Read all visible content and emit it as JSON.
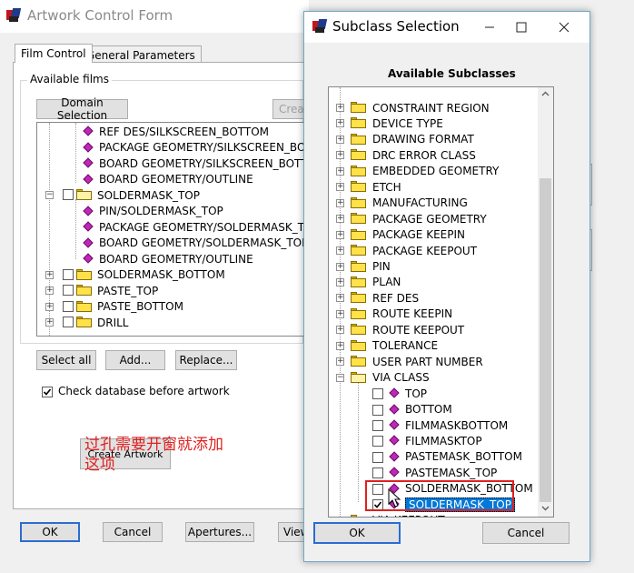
{
  "main_window": {
    "title": "Artwork Control Form",
    "tabs": [
      "Film Control",
      "General Parameters"
    ],
    "available_films_label": "Available films",
    "domain_selection": "Domain Selection",
    "create_partial": "Creat",
    "film_tree": [
      {
        "label": "REF DES/SILKSCREEN_BOTTOM",
        "type": "item",
        "indent": 2
      },
      {
        "label": "PACKAGE GEOMETRY/SILKSCREEN_BO",
        "type": "item",
        "indent": 2
      },
      {
        "label": "BOARD GEOMETRY/SILKSCREEN_BOTT",
        "type": "item",
        "indent": 2
      },
      {
        "label": "BOARD GEOMETRY/OUTLINE",
        "type": "item",
        "indent": 2
      },
      {
        "label": "SOLDERMASK_TOP",
        "type": "folder-open",
        "indent": 1
      },
      {
        "label": "PIN/SOLDERMASK_TOP",
        "type": "item",
        "indent": 2
      },
      {
        "label": "PACKAGE GEOMETRY/SOLDERMASK_T",
        "type": "item",
        "indent": 2
      },
      {
        "label": "BOARD GEOMETRY/SOLDERMASK_TOP",
        "type": "item",
        "indent": 2
      },
      {
        "label": "BOARD GEOMETRY/OUTLINE",
        "type": "item",
        "indent": 2
      },
      {
        "label": "SOLDERMASK_BOTTOM",
        "type": "folder",
        "indent": 1
      },
      {
        "label": "PASTE_TOP",
        "type": "folder",
        "indent": 1
      },
      {
        "label": "PASTE_BOTTOM",
        "type": "folder",
        "indent": 1
      },
      {
        "label": "DRILL",
        "type": "folder",
        "indent": 1
      }
    ],
    "select_all": "Select all",
    "add": "Add...",
    "replace": "Replace...",
    "check_db_label": "Check database before artwork",
    "check_db_checked": true,
    "create_artwork": "Create Artwork",
    "ok": "OK",
    "cancel": "Cancel",
    "apertures": "Apertures...",
    "view_partial": "View"
  },
  "dialog": {
    "title": "Subclass Selection",
    "heading": "Available Subclasses",
    "ok": "OK",
    "cancel": "Cancel",
    "tree": [
      {
        "label": "CONSTRAINT REGION",
        "type": "folder"
      },
      {
        "label": "DEVICE TYPE",
        "type": "folder"
      },
      {
        "label": "DRAWING FORMAT",
        "type": "folder"
      },
      {
        "label": "DRC ERROR CLASS",
        "type": "folder"
      },
      {
        "label": "EMBEDDED GEOMETRY",
        "type": "folder"
      },
      {
        "label": "ETCH",
        "type": "folder"
      },
      {
        "label": "MANUFACTURING",
        "type": "folder"
      },
      {
        "label": "PACKAGE GEOMETRY",
        "type": "folder"
      },
      {
        "label": "PACKAGE KEEPIN",
        "type": "folder"
      },
      {
        "label": "PACKAGE KEEPOUT",
        "type": "folder"
      },
      {
        "label": "PIN",
        "type": "folder"
      },
      {
        "label": "PLAN",
        "type": "folder"
      },
      {
        "label": "REF DES",
        "type": "folder"
      },
      {
        "label": "ROUTE KEEPIN",
        "type": "folder"
      },
      {
        "label": "ROUTE KEEPOUT",
        "type": "folder"
      },
      {
        "label": "TOLERANCE",
        "type": "folder"
      },
      {
        "label": "USER PART NUMBER",
        "type": "folder"
      },
      {
        "label": "VIA CLASS",
        "type": "folder-open"
      },
      {
        "label": "TOP",
        "type": "item",
        "checked": false
      },
      {
        "label": "BOTTOM",
        "type": "item",
        "checked": false
      },
      {
        "label": "FILMMASKBOTTOM",
        "type": "item",
        "checked": false
      },
      {
        "label": "FILMMASKTOP",
        "type": "item",
        "checked": false
      },
      {
        "label": "PASTEMASK_BOTTOM",
        "type": "item",
        "checked": false
      },
      {
        "label": "PASTEMASK_TOP",
        "type": "item",
        "checked": false
      },
      {
        "label": "SOLDERMASK_BOTTOM",
        "type": "item",
        "checked": false
      },
      {
        "label": "SOLDERMASK_TOP",
        "type": "item",
        "checked": true,
        "selected": true
      },
      {
        "label": "VIA KEEPOUT",
        "type": "folder"
      }
    ]
  },
  "annotation": {
    "line1": "过孔需要开窗就添加",
    "line2": "这项",
    "color": "#e02020"
  }
}
